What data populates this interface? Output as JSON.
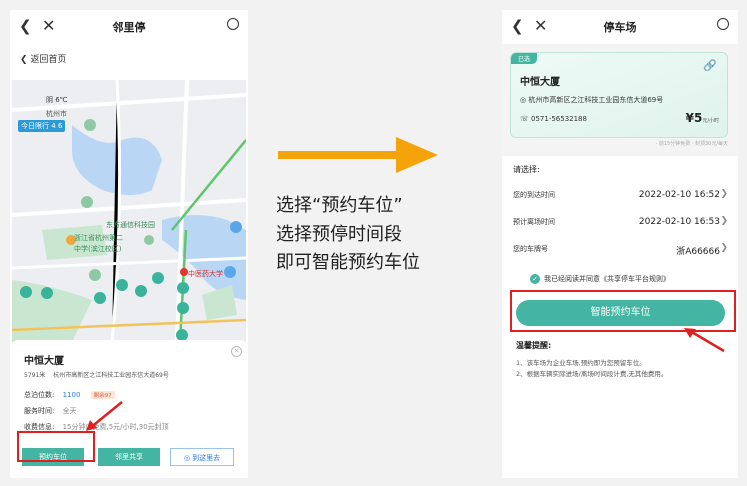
{
  "left": {
    "title": "邻里停",
    "back_home": "返回首页",
    "map": {
      "weather": "阴 6℃",
      "city": "杭州市",
      "traffic_chip": "今日限行 4 6",
      "poi_tech_park": "东方通信科技园",
      "poi_school_1": "浙江省杭州第二",
      "poi_school_2": "中学(滨江校区)",
      "poi_hospital": "中医药大学"
    },
    "lot": {
      "name": "中恒大厦",
      "distance": "5791米",
      "address": "杭州市高新区之江科技工业园东信大道69号",
      "total_label": "总泊位数:",
      "total_value": "1100",
      "remaining": "剩余97",
      "service_label": "服务时间:",
      "service_value": "全天",
      "fee_label": "收费信息:",
      "fee_value": "15分钟内免费,5元/小时,30元封顶"
    },
    "buttons": {
      "reserve": "预约车位",
      "share": "邻里共享",
      "navigate": "到这里去"
    }
  },
  "caption": {
    "line1": "选择“预约车位”",
    "line2": "选择预停时间段",
    "line3": "即可智能预约车位"
  },
  "right": {
    "title": "停车场",
    "card": {
      "badge": "已选",
      "name": "中恒大厦",
      "address": "杭州市高新区之江科技工业园东信大道69号",
      "phone": "0571-56532188",
      "price": "¥5",
      "price_unit": "元/小时",
      "note": "· 前15分钟免费 · 封顶30元/每天"
    },
    "select_title": "请选择:",
    "rows": [
      {
        "label": "您的到达时间",
        "value": "2022-02-10 16:52"
      },
      {
        "label": "预计离场时间",
        "value": "2022-02-10 16:53"
      },
      {
        "label": "您的车牌号",
        "value": "浙A66666"
      }
    ],
    "agree_text": "我已经阅读并同意《共享停车平台规则》",
    "smart_button": "智能预约车位",
    "tips_title": "温馨提醒:",
    "tips_1": "1、该车场为企业车场,预约即为您预留车位。",
    "tips_2": "2、根据车辆实际进场/离场时间段计费,无其他费用。"
  },
  "colors": {
    "accent": "#43b5a2",
    "arrow": "#f5a30a",
    "highlight": "#e02020"
  }
}
